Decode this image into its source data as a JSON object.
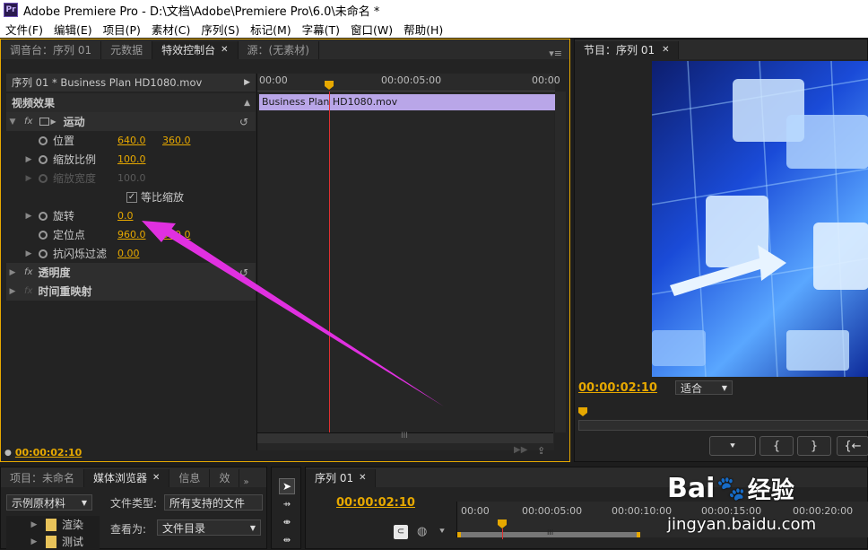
{
  "window": {
    "logo": "Pr",
    "title": "Adobe Premiere Pro - D:\\文档\\Adobe\\Premiere Pro\\6.0\\未命名 *"
  },
  "menu": [
    "文件(F)",
    "编辑(E)",
    "项目(P)",
    "素材(C)",
    "序列(S)",
    "标记(M)",
    "字幕(T)",
    "窗口(W)",
    "帮助(H)"
  ],
  "source_panel": {
    "tabs": [
      "调音台：序列 01",
      "元数据",
      "特效控制台",
      "源：(无素材)"
    ],
    "header": "序列 01 * Business Plan HD1080.mov",
    "section": "视频效果",
    "ruler": [
      "00:00",
      "00:00:05:00",
      "00:00"
    ],
    "clip_name": "Business Plan HD1080.mov",
    "effects": {
      "motion": "运动",
      "position": {
        "label": "位置",
        "x": "640.0",
        "y": "360.0"
      },
      "scale": {
        "label": "缩放比例",
        "value": "100.0"
      },
      "scale_width": {
        "label": "缩放宽度",
        "value": "100.0"
      },
      "uniform_scale": "等比缩放",
      "rotation": {
        "label": "旋转",
        "value": "0.0"
      },
      "anchor": {
        "label": "定位点",
        "x": "960.0",
        "y": "540.0"
      },
      "anti_flicker": {
        "label": "抗闪烁过滤",
        "value": "0.00"
      },
      "opacity": "透明度",
      "time_remap": "时间重映射"
    },
    "timecode": "00:00:02:10",
    "scrollbar_grip": "III"
  },
  "program": {
    "tab": "节目：序列 01",
    "timecode": "00:00:02:10",
    "fit": "适合",
    "buttons": [
      "{",
      "}",
      "{←"
    ]
  },
  "project": {
    "tabs": [
      "项目：未命名",
      "媒体浏览器",
      "信息",
      "效"
    ],
    "example_dropdown": "示例原材料",
    "file_type_label": "文件类型:",
    "file_type_value": "所有支持的文件",
    "view_as_label": "查看为:",
    "view_as_value": "文件目录",
    "folders": [
      "渲染",
      "测试"
    ]
  },
  "timeline": {
    "tab": "序列 01",
    "timecode": "00:00:02:10",
    "ruler": [
      "00:00",
      "00:00:05:00",
      "00:00:10:00",
      "00:00:15:00",
      "00:00:20:00"
    ],
    "grip": "III"
  },
  "watermark": {
    "brand": "Bai",
    "brand2": "经验",
    "url": "jingyan.baidu.com"
  },
  "colors": {
    "accent": "#e6a800",
    "clip": "#b9a6e8",
    "arrow": "#e030e0",
    "playhead": "#e03030"
  }
}
